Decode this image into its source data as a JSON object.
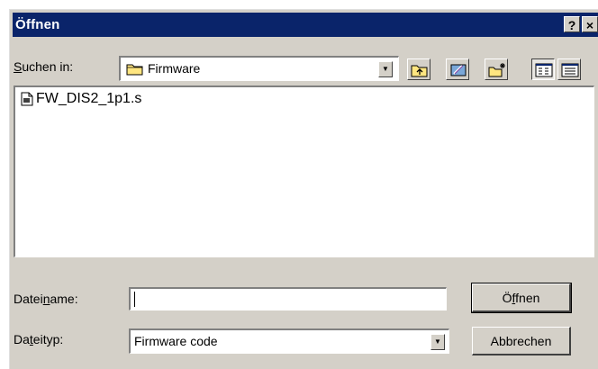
{
  "window": {
    "title": "Öffnen",
    "help_button": "?",
    "close_button": "×"
  },
  "lookin": {
    "label_prefix": "S",
    "label_rest": "uchen in:",
    "value": "Firmware"
  },
  "toolbar": {
    "icons": [
      "up-folder-icon",
      "desktop-icon",
      "new-folder-icon",
      "list-view-icon",
      "details-view-icon"
    ]
  },
  "files": [
    {
      "name": "FW_DIS2_1p1.s",
      "icon": "file-icon"
    }
  ],
  "filename": {
    "label_before": "Datei",
    "label_u": "n",
    "label_after": "ame:",
    "value": ""
  },
  "filetype": {
    "label_before": "Da",
    "label_u": "t",
    "label_after": "eityp:",
    "value": "Firmware code"
  },
  "buttons": {
    "open_before": "Ö",
    "open_u": "f",
    "open_after": "fnen",
    "cancel": "Abbrechen"
  }
}
